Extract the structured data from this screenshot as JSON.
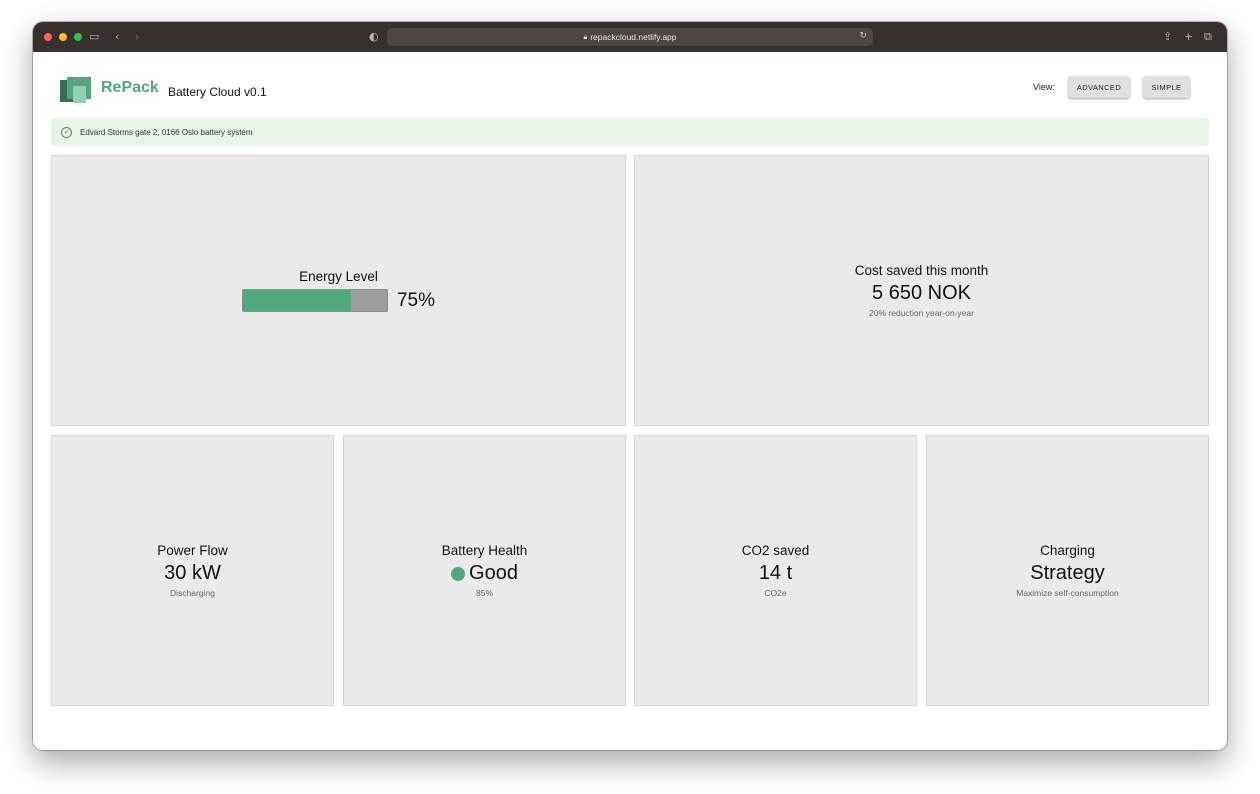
{
  "browser": {
    "url": "repackcloud.netlify.app"
  },
  "header": {
    "brand": "RePack",
    "app_title": "Battery Cloud v0.1",
    "view_label": "View:",
    "advanced_label": "ADVANCED",
    "simple_label": "SIMPLE"
  },
  "alert": {
    "message": "Edvard Storms gate 2, 0166 Oslo battery system"
  },
  "energy": {
    "title": "Energy Level",
    "value": "75%",
    "level": 0.75
  },
  "cost": {
    "title": "Cost saved this month",
    "value": "5 650 NOK",
    "sub": "20% reduction year-on-year"
  },
  "power": {
    "title": "Power Flow",
    "value": "30 kW",
    "sub": "Discharging"
  },
  "health": {
    "title": "Battery Health",
    "value": "Good",
    "sub": "85%",
    "status_color": "#52a77f"
  },
  "co2": {
    "title": "CO2 saved",
    "value": "14 t",
    "sub": "CO2e"
  },
  "charging": {
    "title": "Charging",
    "value": "Strategy",
    "sub": "Maximize self-consumption"
  },
  "colors": {
    "accent": "#52a77f",
    "card_bg": "#eaeaea",
    "alert_bg": "#e9f4e9"
  },
  "icons": [
    "sidebar-icon",
    "back-icon",
    "forward-icon",
    "shield-icon",
    "lock-icon",
    "reload-icon",
    "share-icon",
    "new-tab-icon",
    "tabs-icon",
    "check-circle-icon"
  ]
}
